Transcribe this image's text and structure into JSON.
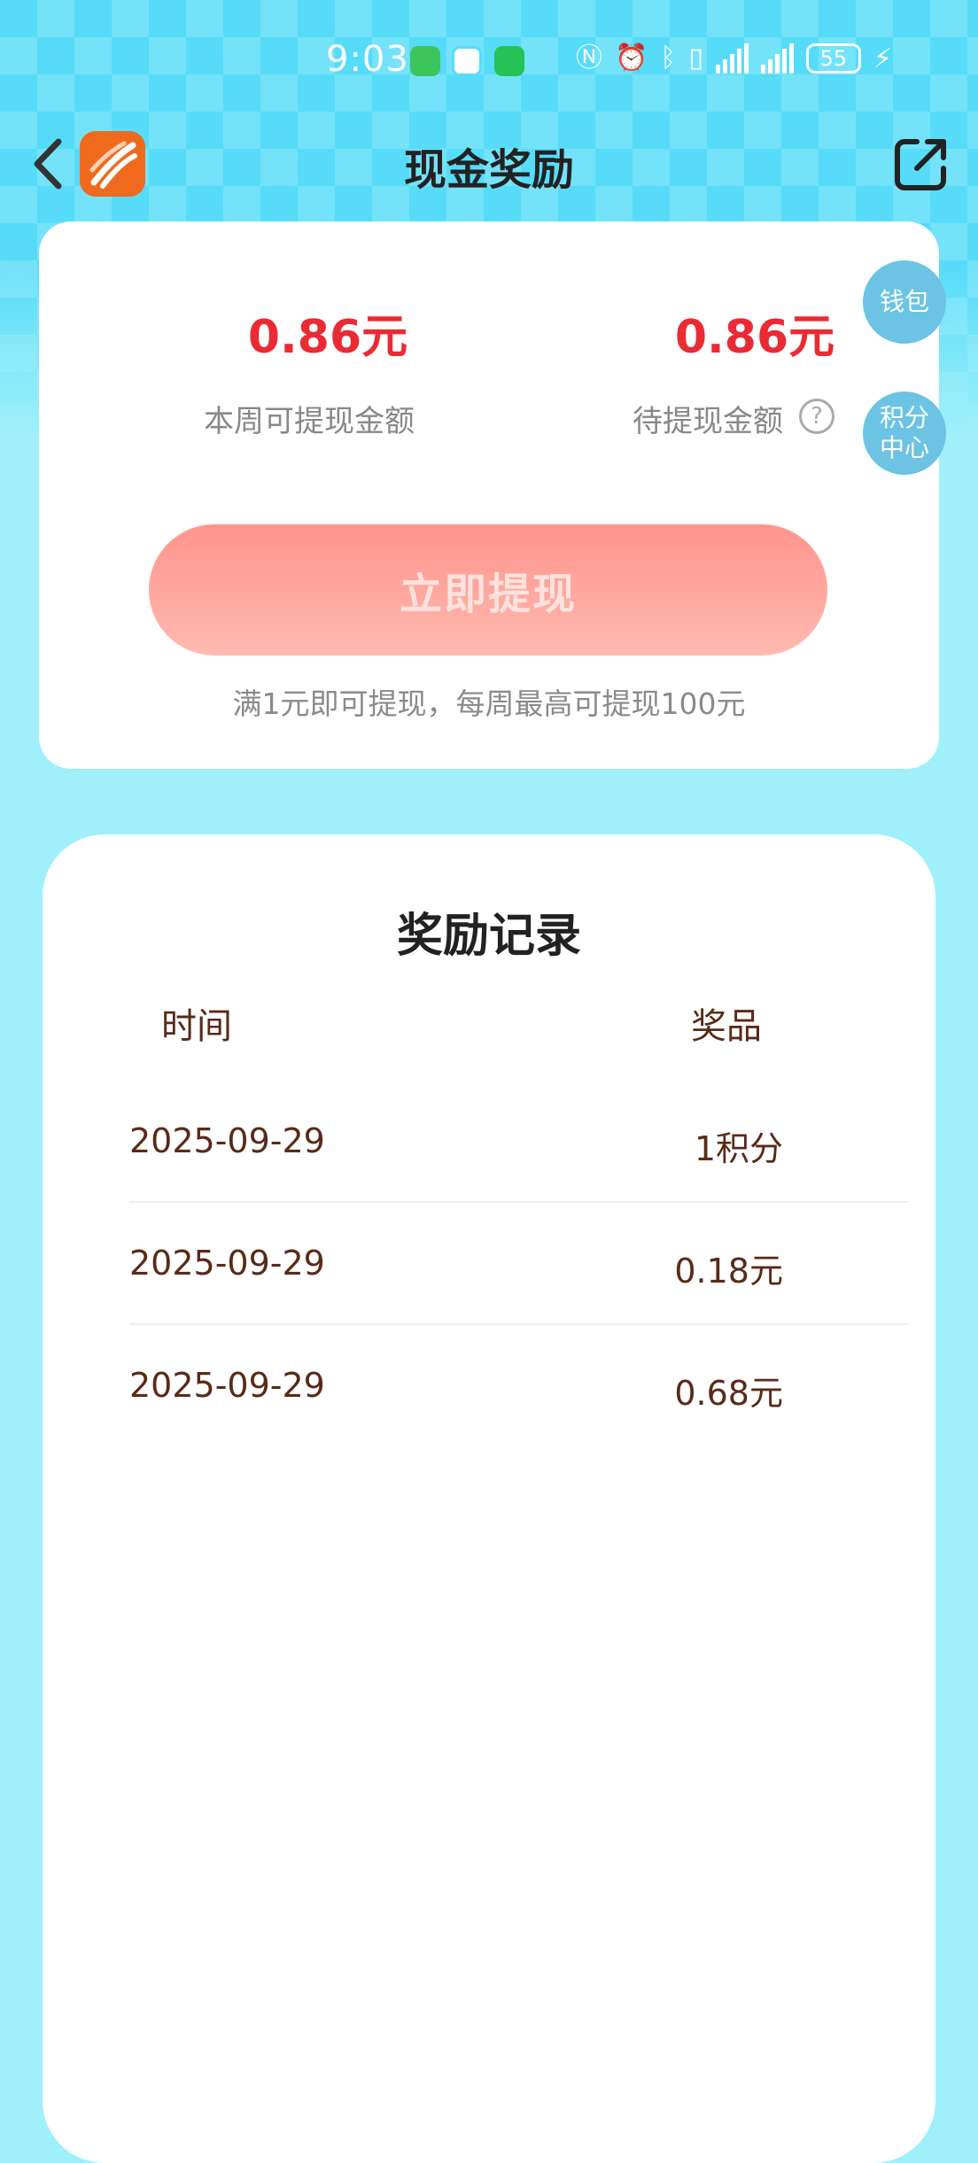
{
  "status_bar": {
    "time": "9:03",
    "battery": "55"
  },
  "header": {
    "title": "现金奖励"
  },
  "summary": {
    "weekly_amount": "0.86元",
    "weekly_label": "本周可提现金额",
    "pending_amount": "0.86元",
    "pending_label": "待提现金额",
    "help_glyph": "?",
    "withdraw_button": "立即提现",
    "withdraw_note": "满1元即可提现，每周最高可提现100元"
  },
  "side_buttons": {
    "wallet": "钱包",
    "points_line1": "积分",
    "points_line2": "中心"
  },
  "records": {
    "title": "奖励记录",
    "columns": [
      "时间",
      "奖品"
    ],
    "rows": [
      {
        "date": "2025-09-29",
        "prize": "1积分"
      },
      {
        "date": "2025-09-29",
        "prize": "0.18元"
      },
      {
        "date": "2025-09-29",
        "prize": "0.68元"
      }
    ]
  },
  "colors": {
    "accent_red": "#ea2a34",
    "button_gradient_top": "#ff948d",
    "button_gradient_bottom": "#ffbab0",
    "background": "#9ff0fb",
    "hero": "#56dcf8",
    "side_button": "#6cc3e3"
  }
}
